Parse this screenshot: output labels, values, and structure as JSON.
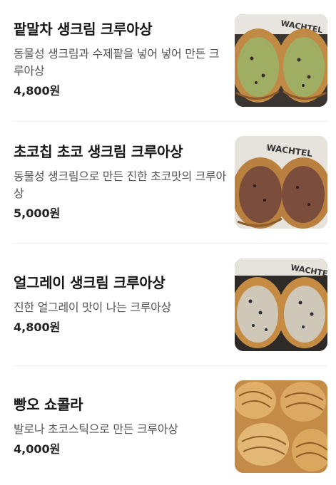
{
  "menu": {
    "items": [
      {
        "name": "팥말차 생크림 크루아상",
        "description": "동물성 생크림과 수제팥을 넣어 넣어 만든 크루아상",
        "price": "4,800원",
        "image_icon": "matcha-croissant-photo",
        "filling_color": "#9fae62"
      },
      {
        "name": "초코칩 초코 생크림 크루아상",
        "description": "동물성 생크림으로 만든 진한 초코맛의 크루아상",
        "price": "5,000원",
        "image_icon": "chocolate-croissant-photo",
        "filling_color": "#7a4d3c"
      },
      {
        "name": "얼그레이 생크림 크루아상",
        "description": "진한 얼그레이 맛이 나는 크루아상",
        "price": "4,800원",
        "image_icon": "earl-grey-croissant-photo",
        "filling_color": "#cfc7b8"
      },
      {
        "name": "빵오 쇼콜라",
        "description": "발로나 초코스틱으로 만든 크루아상",
        "price": "4,000원",
        "image_icon": "pain-au-chocolat-photo",
        "filling_color": "#d29a55"
      }
    ]
  }
}
